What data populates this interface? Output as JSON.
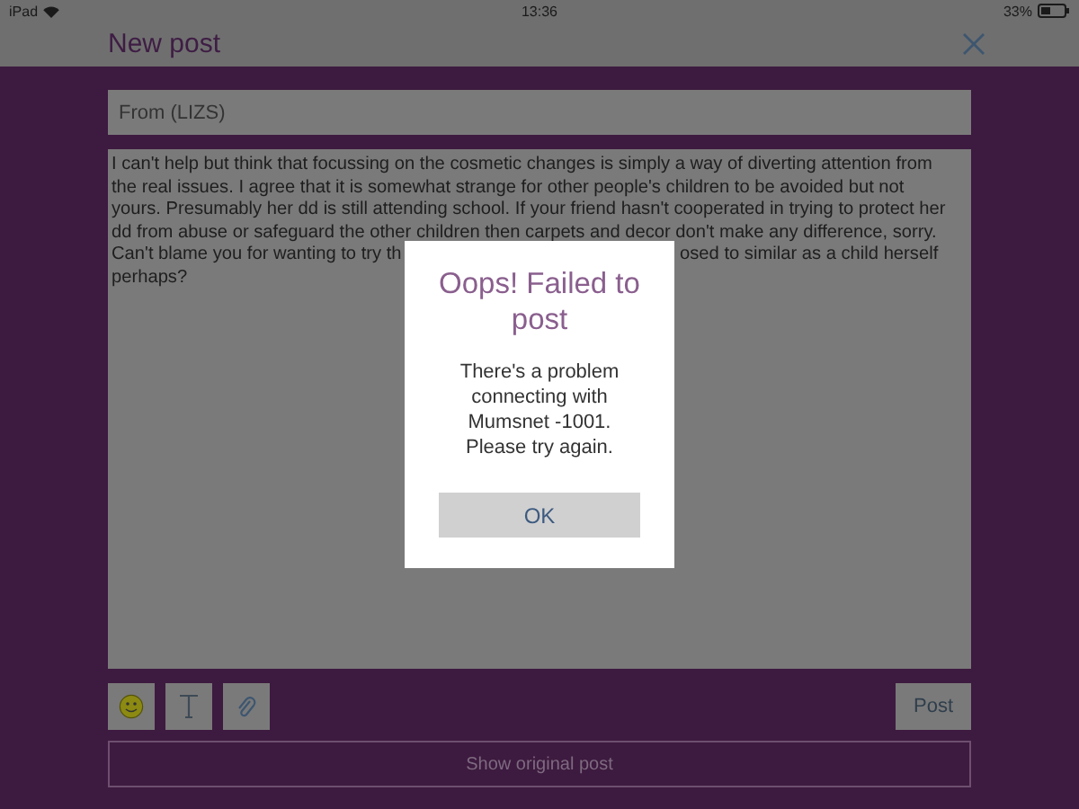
{
  "status_bar": {
    "device": "iPad",
    "time": "13:36",
    "battery": "33%"
  },
  "header": {
    "title": "New post"
  },
  "from_field": {
    "placeholder": "From (LIZS)"
  },
  "message": {
    "lines": [
      "I can't help but think that focussing on the cosmetic changes is simply a way of diverting attention from",
      "the real issues. I agree that it is somewhat strange for other people's children to be avoided but not",
      "yours. Presumably her dd is still attending school. If your friend hasn't cooperated in trying to protect her",
      "dd from abuse or safeguard the other children then carpets and decor don't make any difference, sorry.",
      "Can't blame you for wanting to try th",
      "osed to similar as a child herself",
      "perhaps?"
    ]
  },
  "toolbar": {
    "post_button": "Post"
  },
  "show_original_button": "Show original post",
  "dialog": {
    "title": "Oops! Failed to post",
    "message": "There's a problem connecting with Mumsnet -1001. Please try again.",
    "button": "OK"
  }
}
